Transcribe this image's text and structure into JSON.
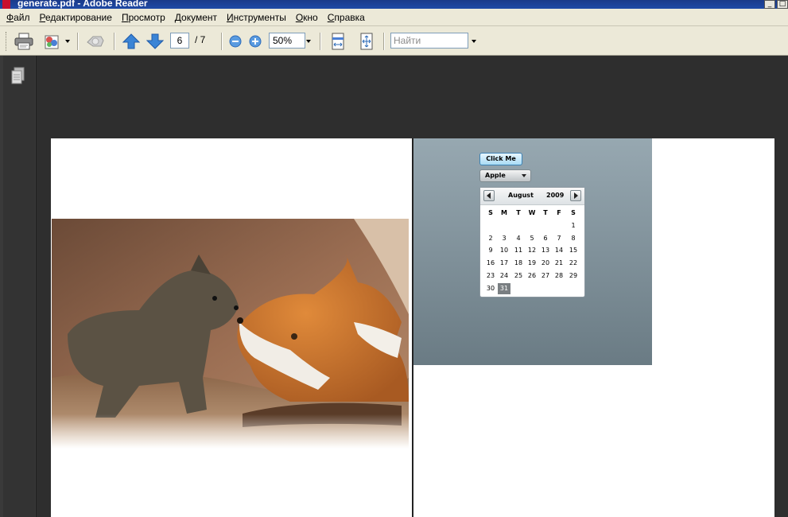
{
  "window": {
    "title": "generate.pdf - Adobe Reader",
    "controls": [
      "_",
      "□"
    ]
  },
  "menu": {
    "items": [
      {
        "hot": "Ф",
        "rest": "айл"
      },
      {
        "hot": "Р",
        "rest": "едактирование"
      },
      {
        "hot": "П",
        "rest": "росмотр"
      },
      {
        "hot": "Д",
        "rest": "окумент"
      },
      {
        "hot": "И",
        "rest": "нструменты"
      },
      {
        "hot": "О",
        "rest": "кно"
      },
      {
        "hot": "С",
        "rest": "правка"
      }
    ]
  },
  "toolbar": {
    "current_page": "6",
    "total_pages": "/ 7",
    "zoom": "50%",
    "find_placeholder": "Найти"
  },
  "icons": {
    "print": "printer-icon",
    "collaborate": "collaborate-icon",
    "hand": "hand-icon",
    "prev_page": "arrow-up-icon",
    "next_page": "arrow-down-icon",
    "zoom_out": "zoom-out-icon",
    "zoom_in": "zoom-in-icon",
    "fit_width": "fit-width-icon",
    "fit_page": "fit-page-icon",
    "pages_panel": "pages-icon"
  },
  "flex_app": {
    "button_label": "Click Me",
    "combo_value": "Apple",
    "calendar": {
      "month": "August",
      "year": "2009",
      "weekdays": [
        "S",
        "M",
        "T",
        "W",
        "T",
        "F",
        "S"
      ],
      "weeks": [
        [
          "",
          "",
          "",
          "",
          "",
          "",
          "1"
        ],
        [
          "2",
          "3",
          "4",
          "5",
          "6",
          "7",
          "8"
        ],
        [
          "9",
          "10",
          "11",
          "12",
          "13",
          "14",
          "15"
        ],
        [
          "16",
          "17",
          "18",
          "19",
          "20",
          "21",
          "22"
        ],
        [
          "23",
          "24",
          "25",
          "26",
          "27",
          "28",
          "29"
        ],
        [
          "30",
          "31",
          "",
          "",
          "",
          "",
          ""
        ]
      ],
      "selected": "31"
    }
  },
  "colors": {
    "accent_blue": "#1f4aa6",
    "panel_top": "#97a8b1",
    "panel_bottom": "#6a7b84",
    "selected_day": "#7a7f82"
  }
}
